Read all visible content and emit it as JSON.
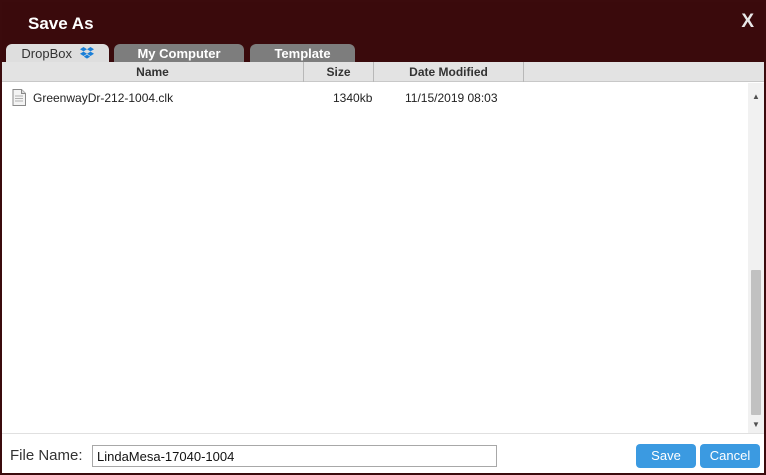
{
  "dialog": {
    "title": "Save As",
    "close_symbol": "X"
  },
  "tabs": [
    {
      "label": "DropBox",
      "icon": "dropbox-icon",
      "active": true
    },
    {
      "label": "My Computer",
      "active": false
    },
    {
      "label": "Template",
      "active": false
    }
  ],
  "columns": [
    "Name",
    "Size",
    "Date Modified"
  ],
  "files": [
    {
      "icon": "file-icon",
      "name": "GreenwayDr-212-1004.clk",
      "size": "1340kb",
      "date": "11/15/2019 08:03"
    }
  ],
  "footer": {
    "filename_label": "File Name:",
    "filename_value": "LindaMesa-17040-1004",
    "save_label": "Save",
    "cancel_label": "Cancel"
  },
  "colors": {
    "titlebar": "#3a0a0c",
    "tab_inactive": "#7d7d7d",
    "tab_active": "#dedede",
    "button": "#3b9ae1",
    "dropbox": "#1a7fd8"
  }
}
